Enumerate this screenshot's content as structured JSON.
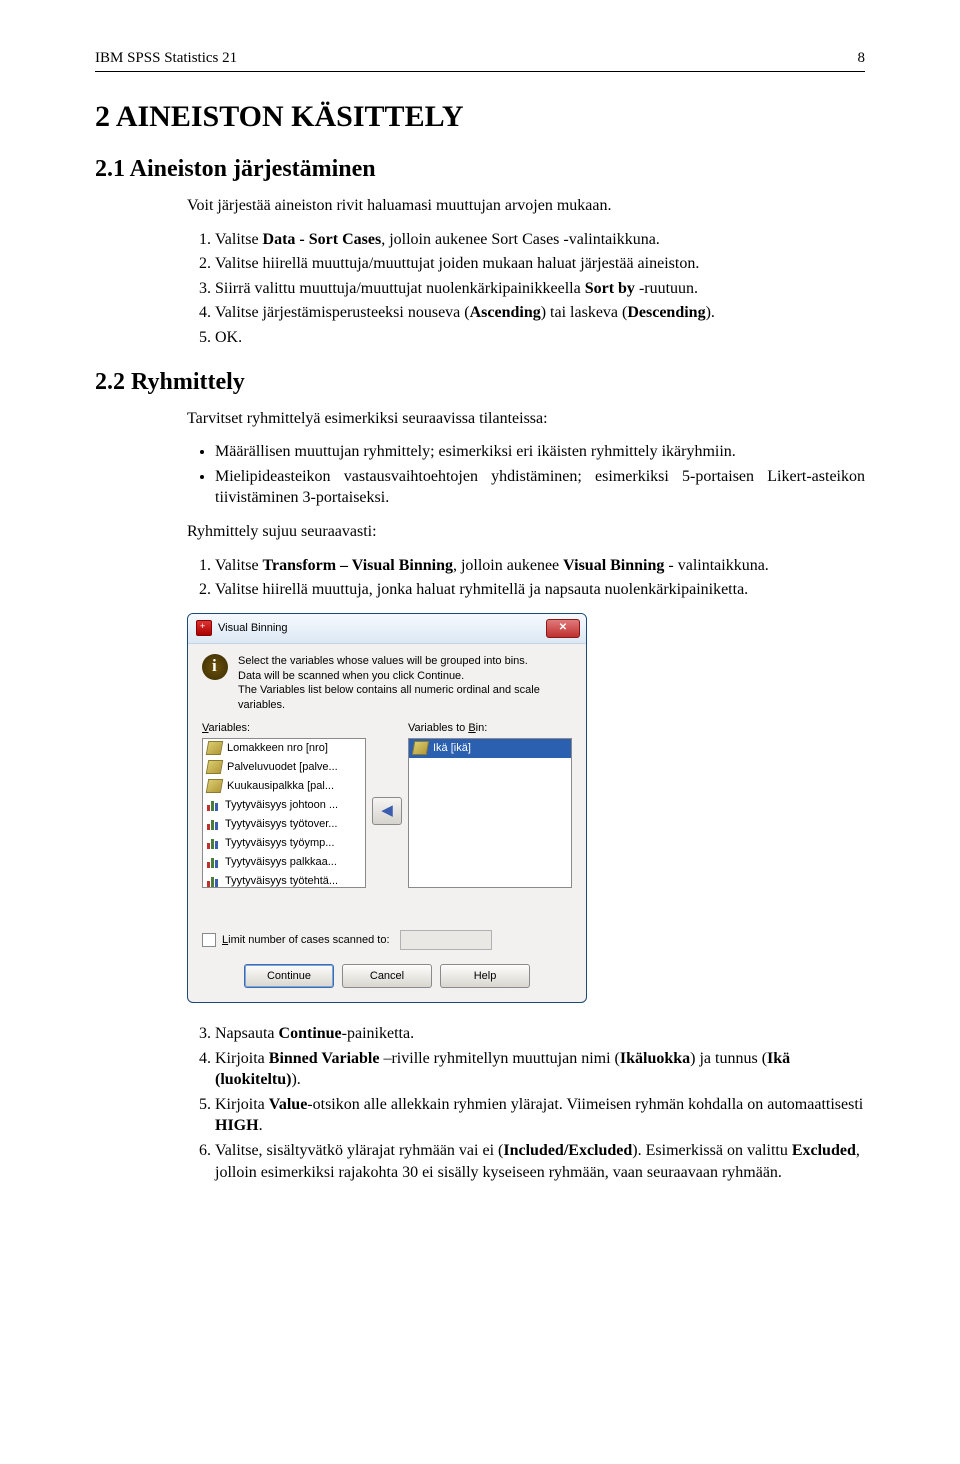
{
  "header": {
    "title": "IBM SPSS Statistics 21",
    "page": "8"
  },
  "h1": "2 AINEISTON KÄSITTELY",
  "sec1": {
    "heading": "2.1 Aineiston järjestäminen",
    "intro": "Voit järjestää aineiston rivit haluamasi muuttujan arvojen mukaan.",
    "steps": {
      "s1a": "Valitse ",
      "s1b": "Data - Sort Cases",
      "s1c": ", jolloin aukenee Sort Cases -valintaikkuna.",
      "s2": "Valitse hiirellä muuttuja/muuttujat joiden mukaan haluat järjestää aineiston.",
      "s3a": "Siirrä valittu muuttuja/muuttujat nuolenkärkipainikkeella ",
      "s3b": "Sort by",
      "s3c": " -ruutuun.",
      "s4a": "Valitse järjestämisperusteeksi nouseva (",
      "s4b": "Ascending",
      "s4c": ") tai laskeva (",
      "s4d": "Descending",
      "s4e": ").",
      "s5": "OK."
    }
  },
  "sec2": {
    "heading": "2.2 Ryhmittely",
    "intro": "Tarvitset ryhmittelyä esimerkiksi seuraavissa tilanteissa:",
    "b1": "Määrällisen muuttujan ryhmittely; esimerkiksi eri ikäisten ryhmittely ikäryhmiin.",
    "b2": "Mielipideasteikon vastausvaihtoehtojen yhdistäminen; esimerkiksi 5-portaisen Likert-asteikon tiivistäminen 3-portaiseksi.",
    "lead2": "Ryhmittely sujuu seuraavasti:",
    "stepsA": {
      "s1a": "Valitse ",
      "s1b": "Transform – Visual Binning",
      "s1c": ", jolloin aukenee ",
      "s1d": "Visual Binning",
      "s1e": " - valintaikkuna.",
      "s2": "Valitse hiirellä muuttuja, jonka haluat ryhmitellä ja napsauta nuolenkärkipainiketta."
    },
    "stepsB": {
      "s3a": "Napsauta ",
      "s3b": "Continue",
      "s3c": "-painiketta.",
      "s4a": "Kirjoita ",
      "s4b": "Binned Variable",
      "s4c": " –riville ryhmitellyn muuttujan nimi (",
      "s4d": "Ikäluokka",
      "s4e": ") ja tunnus (",
      "s4f": "Ikä (luokiteltu)",
      "s4g": ").",
      "s5a": "Kirjoita ",
      "s5b": "Value",
      "s5c": "-otsikon alle allekkain ryhmien ylärajat. Viimeisen ryhmän kohdalla on automaattisesti ",
      "s5d": "HIGH",
      "s5e": ".",
      "s6a": "Valitse, sisältyvätkö ylärajat ryhmään vai ei (",
      "s6b": "Included/Excluded",
      "s6c": "). Esimerkissä on valittu ",
      "s6d": "Excluded",
      "s6e": ", jolloin esimerkiksi rajakohta 30 ei sisälly kyseiseen ryhmään, vaan seuraavaan ryhmään."
    }
  },
  "dialog": {
    "title": "Visual Binning",
    "info1": "Select the variables whose values will be grouped into bins.",
    "info2": "Data will be scanned when you click Continue.",
    "info3": "The Variables list below contains all numeric ordinal and scale variables.",
    "labelVars": "Variables:",
    "labelBin": "Variables to Bin:",
    "vars": [
      "Lomakkeen nro [nro]",
      "Palveluvuodet [palve...",
      "Kuukausipalkka [pal...",
      "Tyytyväisyys johtoon ...",
      "Tyytyväisyys työtover...",
      "Tyytyväisyys työymp...",
      "Tyytyväisyys palkkaa...",
      "Tyytyväisyys työtehtä..."
    ],
    "bin": "Ikä [ikä]",
    "limitLabel": "Limit number of cases scanned to:",
    "btnContinue": "Continue",
    "btnCancel": "Cancel",
    "btnHelp": "Help"
  }
}
